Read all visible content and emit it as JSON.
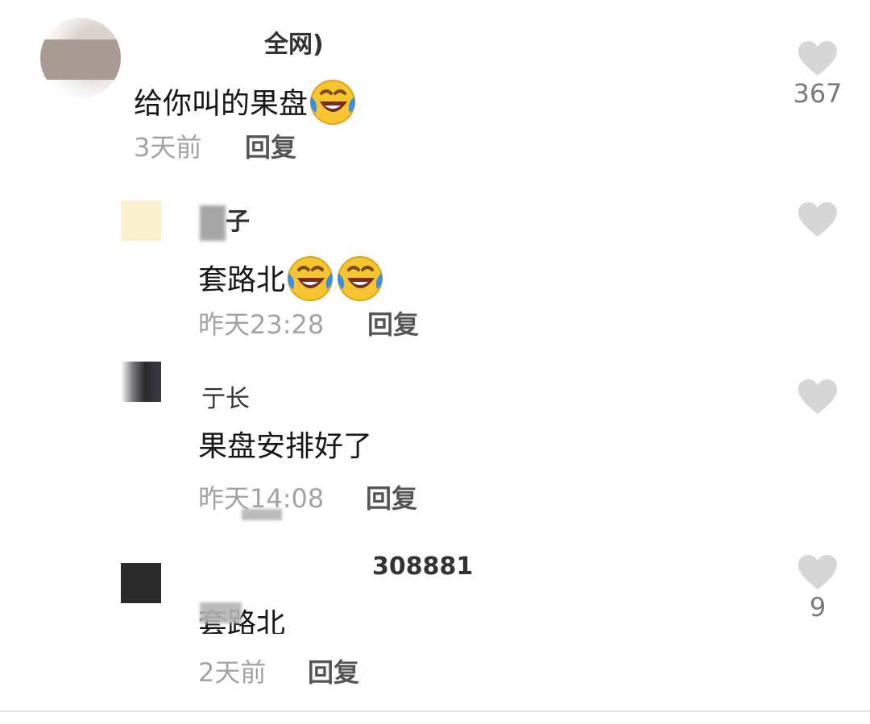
{
  "comments": [
    {
      "username": "全网)",
      "text": "给你叫的果盘",
      "emoji": "rolling-laughing-emoji",
      "time": "3天前",
      "reply_label": "回复",
      "likes": "367"
    },
    {
      "username": "子",
      "text": "套路北",
      "emoji": "rolling-laughing-emoji",
      "time": "昨天23:28",
      "reply_label": "回复",
      "likes": ""
    },
    {
      "username": "亍长",
      "text": "果盘安排好了",
      "time": "昨天14:08",
      "reply_label": "回复",
      "likes": ""
    },
    {
      "username": "308881",
      "text": "套路北",
      "time": "2天前",
      "reply_label": "回复",
      "likes": "9"
    }
  ],
  "icons": {
    "like": "heart-icon"
  },
  "colors": {
    "heart": "#d6d6d6",
    "avatar_yellow": "#fbf1cf",
    "avatar_dark": "#2b2b2b"
  }
}
